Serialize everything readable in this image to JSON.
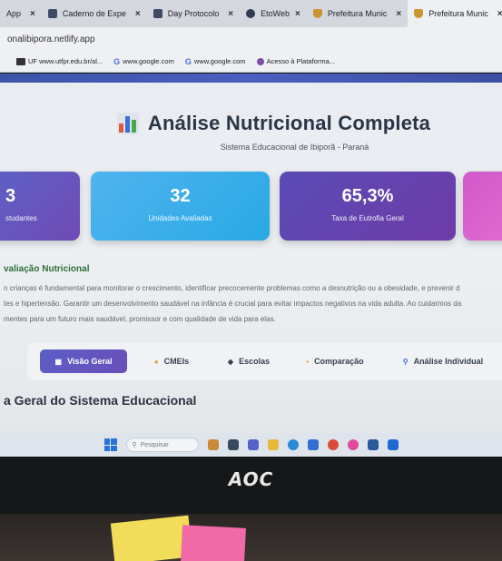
{
  "browser": {
    "tabs": [
      {
        "label": "App",
        "icon": "app-icon"
      },
      {
        "label": "Caderno de Expe",
        "icon": "notebook-icon"
      },
      {
        "label": "Day Protocolo",
        "icon": "protocol-icon"
      },
      {
        "label": "EtoWeb",
        "icon": "globe-icon"
      },
      {
        "label": "Prefeitura Munic",
        "icon": "crest-icon"
      },
      {
        "label": "Prefeitura Munic",
        "icon": "crest-icon"
      }
    ],
    "address": "onalibipora.netlify.app",
    "bookmarks": [
      {
        "label": "UF www.utfpr.edu.br/al...",
        "icon": "utfpr-icon"
      },
      {
        "label": "www.google.com",
        "icon": "google-icon"
      },
      {
        "label": "www.google.com",
        "icon": "google-icon"
      },
      {
        "label": "Acesso à Plataforma...",
        "icon": "platform-icon"
      }
    ]
  },
  "header": {
    "title": "Análise Nutricional Completa",
    "subtitle": "Sistema Educacional de Ibiporã - Paraná"
  },
  "stats": [
    {
      "value": "3",
      "label": "studantes",
      "color": "#5a64c9"
    },
    {
      "value": "32",
      "label": "Unidades Avaliadas",
      "color": "#4fb3ee"
    },
    {
      "value": "65,3%",
      "label": "Taxa de Eutrofia Geral",
      "color": "#5a4bb5"
    },
    {
      "value": "",
      "label": "",
      "color": "#d05ac8"
    }
  ],
  "section": {
    "title": "valiação Nutricional",
    "lines": [
      "n crianças é fundamental para monitorar o crescimento, identificar precocemente problemas como a desnutrição ou a obesidade, e prevenir d",
      "tes e hipertensão. Garantir um desenvolvimento saudável na infância é crucial para evitar impactos negativos na vida adulta. Ao cuidarmos da",
      "mentes para um futuro mais saudável, promissor e com qualidade de vida para elas."
    ]
  },
  "nav": {
    "tabs": [
      {
        "label": "Visão Geral",
        "icon": "chart-icon",
        "active": true
      },
      {
        "label": "CMEIs",
        "icon": "building-icon",
        "active": false
      },
      {
        "label": "Escolas",
        "icon": "school-icon",
        "active": false
      },
      {
        "label": "Comparação",
        "icon": "compare-icon",
        "active": false
      },
      {
        "label": "Análise Individual",
        "icon": "search-icon",
        "active": false
      }
    ]
  },
  "overview": {
    "heading": "a Geral do Sistema Educacional"
  },
  "taskbar": {
    "search_placeholder": "Pesquisar"
  },
  "monitor": {
    "brand": "AOC"
  }
}
